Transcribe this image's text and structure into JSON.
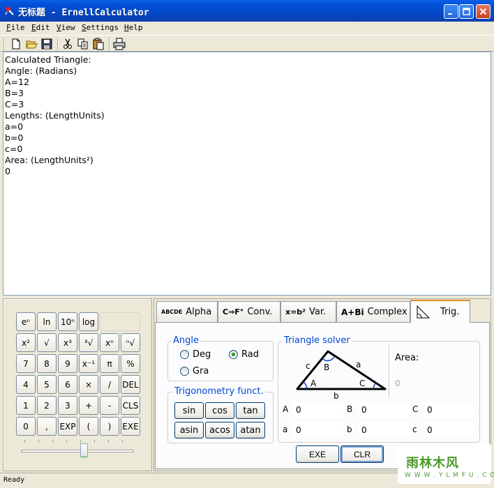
{
  "window": {
    "title": "无标题 - ErnellCalculator",
    "icon": "app-logo-icon"
  },
  "menu": [
    "File",
    "Edit",
    "View",
    "Settings",
    "Help"
  ],
  "toolbar": {
    "icons": [
      "new-file-icon",
      "open-folder-icon",
      "save-icon",
      "cut-icon",
      "copy-icon",
      "paste-icon",
      "print-icon"
    ]
  },
  "output": {
    "lines": [
      "Calculated Triangle:",
      "Angle: (Radians)",
      "A=12",
      "B=3",
      "C=3",
      "Lengths: (LengthUnits)",
      "a=0",
      "b=0",
      "c=0",
      "Area: (LengthUnits²)",
      "0"
    ]
  },
  "keypad": {
    "rows": [
      [
        "eⁿ",
        "ln",
        "10ⁿ",
        "log",
        ""
      ],
      [
        "x²",
        "√",
        "x³",
        "³√",
        "xⁿ",
        "ⁿ√"
      ],
      [
        "7",
        "8",
        "9",
        "x⁻¹",
        "π",
        "%"
      ],
      [
        "4",
        "5",
        "6",
        "×",
        "/",
        "DEL"
      ],
      [
        "1",
        "2",
        "3",
        "+",
        "-",
        "CLS"
      ],
      [
        "0",
        ",",
        "EXP",
        "(",
        ")",
        "EXE"
      ]
    ],
    "slider_position": 0.55
  },
  "tabs": [
    {
      "icon": "ABCDE",
      "label": "Alpha"
    },
    {
      "icon": "C⇒F°",
      "label": "Conv."
    },
    {
      "icon": "x=b²",
      "label": "Var."
    },
    {
      "icon": "A+Bi",
      "label": "Complex"
    },
    {
      "icon": "triangle-ruler-icon",
      "label": "Trig."
    }
  ],
  "trig": {
    "angle_group": {
      "title": "Angle",
      "options": [
        "Deg",
        "Rad",
        "Gra"
      ],
      "selected": "Rad"
    },
    "functions_group": {
      "title": "Trigonometry funct.",
      "buttons": [
        "sin",
        "cos",
        "tan",
        "asin",
        "acos",
        "atan"
      ]
    },
    "solver_group": {
      "title": "Triangle solver",
      "diagram_labels": {
        "c": "c",
        "B": "B",
        "a": "a",
        "A": "A",
        "C": "C",
        "b": "b"
      },
      "area_label": "Area:",
      "area_value": "0"
    },
    "fields": [
      {
        "label": "A",
        "value": "0"
      },
      {
        "label": "B",
        "value": "0"
      },
      {
        "label": "C",
        "value": "0"
      },
      {
        "label": "a",
        "value": "0"
      },
      {
        "label": "b",
        "value": "0"
      },
      {
        "label": "c",
        "value": "0"
      }
    ],
    "actions": {
      "exe": "EXE",
      "clr": "CLR"
    }
  },
  "status": "Ready",
  "watermark": {
    "text": "雨林木风",
    "sub": "W W W . Y L M F U . C O M"
  }
}
